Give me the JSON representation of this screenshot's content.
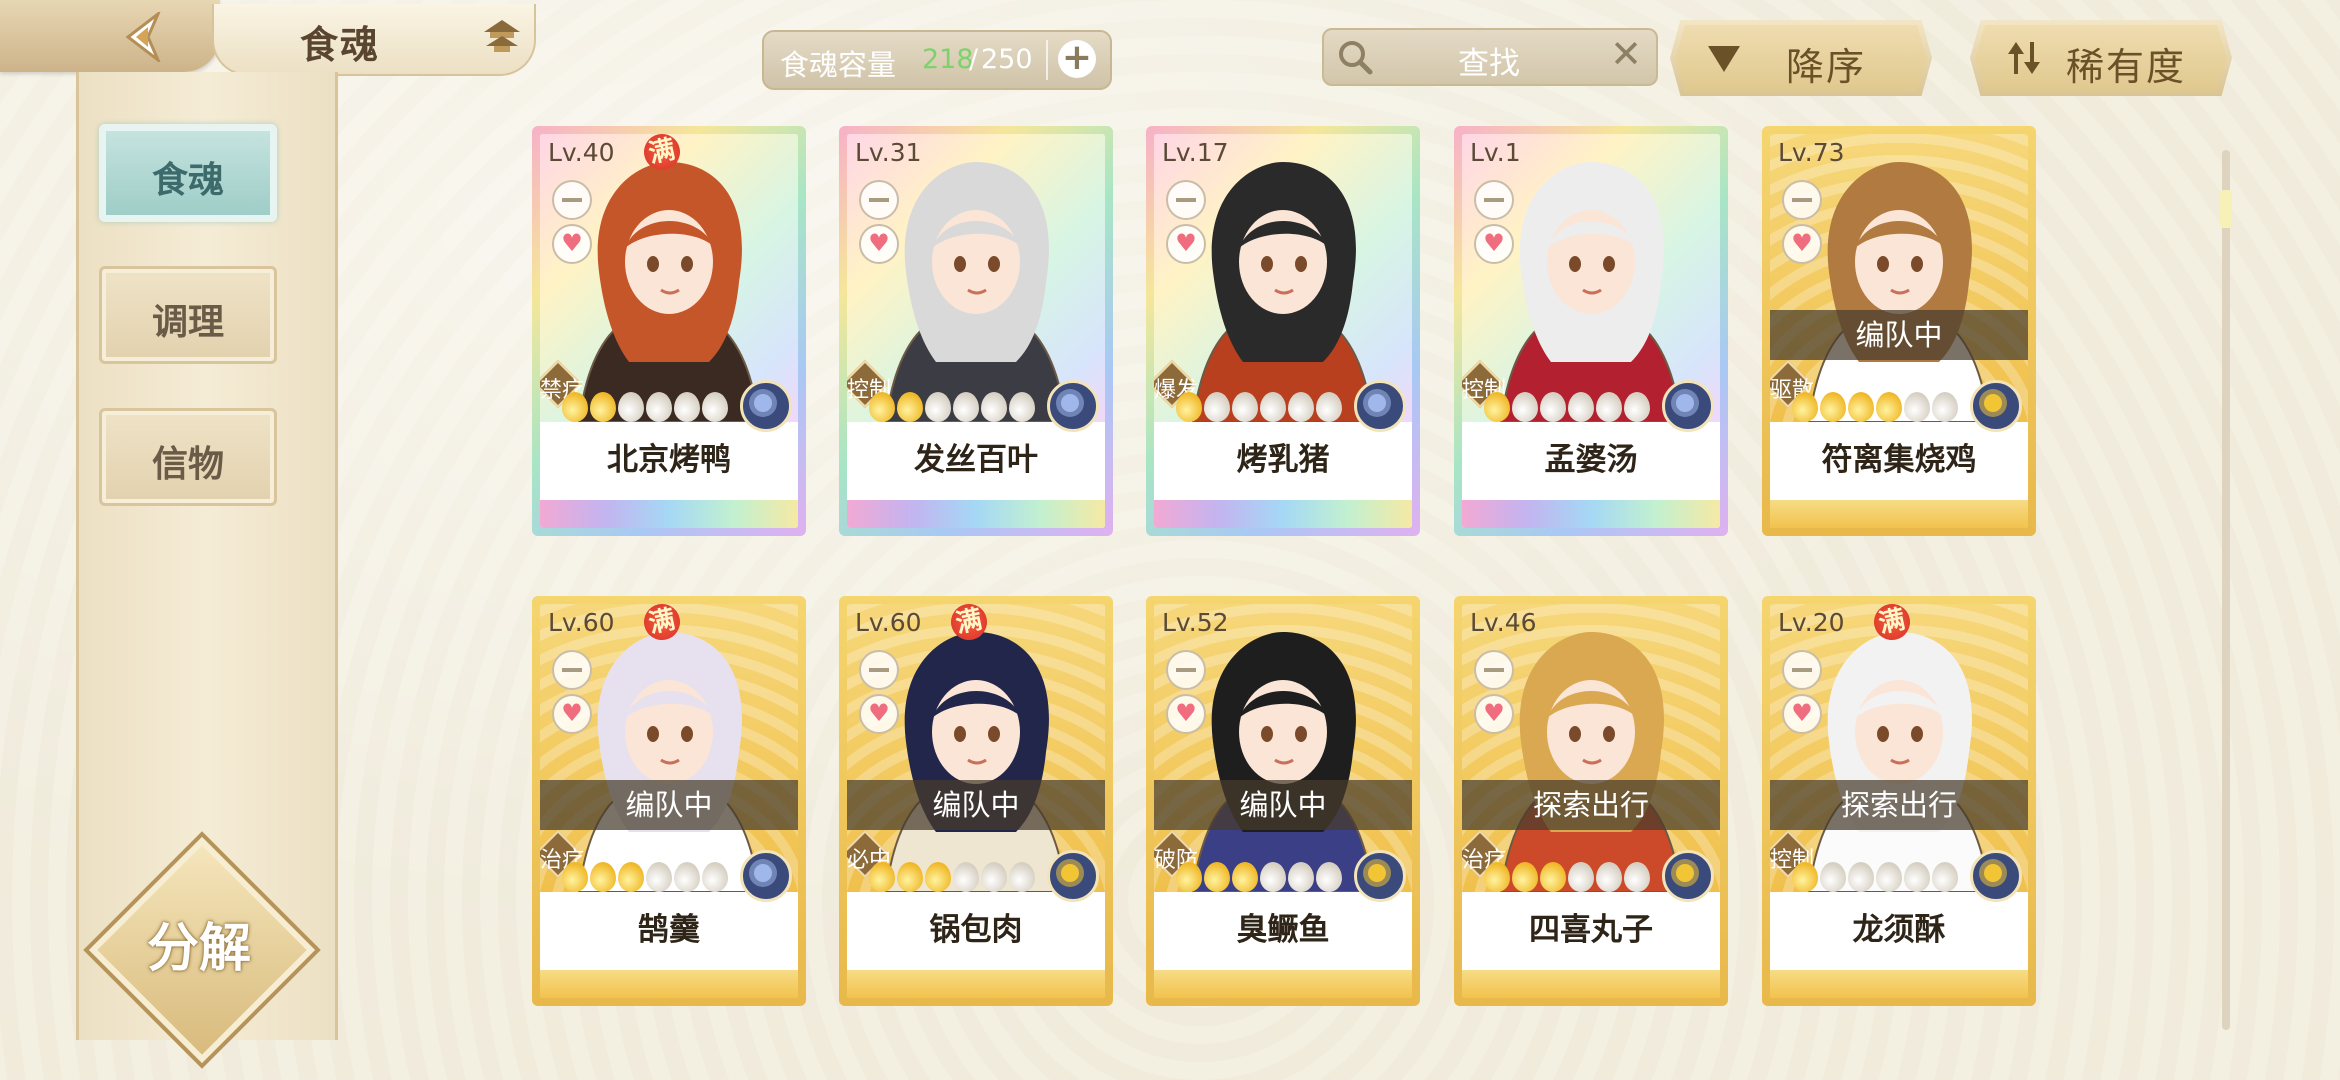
{
  "header": {
    "title": "食魂",
    "capacity": {
      "label": "食魂容量",
      "current": "218",
      "sep": "/",
      "max": "250",
      "plus": "+"
    },
    "search": {
      "placeholder": "查找",
      "clear": "✕"
    },
    "sort_order": "降序",
    "sort_by": "稀有度"
  },
  "sidebar": {
    "tabs": [
      {
        "label": "食魂",
        "active": true
      },
      {
        "label": "调理",
        "active": false
      },
      {
        "label": "信物",
        "active": false
      }
    ],
    "decompose_label": "分解"
  },
  "cards": [
    {
      "level": "Lv.40",
      "full": "满",
      "role": "禁疗",
      "name": "北京烤鸭",
      "frame": "rainbow",
      "stars_on": 2,
      "status": "",
      "emblem": "flower",
      "hair": "#c4562a",
      "outfit": "#3a2a22"
    },
    {
      "level": "Lv.31",
      "full": "",
      "role": "控制",
      "name": "发丝百叶",
      "frame": "rainbow",
      "stars_on": 2,
      "status": "",
      "emblem": "flower",
      "hair": "#d9d9d9",
      "outfit": "#3c3c44"
    },
    {
      "level": "Lv.17",
      "full": "",
      "role": "爆发",
      "name": "烤乳猪",
      "frame": "rainbow",
      "stars_on": 1,
      "status": "",
      "emblem": "flower",
      "hair": "#2a2a2a",
      "outfit": "#b8401e"
    },
    {
      "level": "Lv.1",
      "full": "",
      "role": "控制",
      "name": "孟婆汤",
      "frame": "rainbow",
      "stars_on": 1,
      "status": "",
      "emblem": "flower",
      "hair": "#ededed",
      "outfit": "#b32030"
    },
    {
      "level": "Lv.73",
      "full": "",
      "role": "驱散",
      "name": "符离集烧鸡",
      "frame": "gold",
      "stars_on": 4,
      "status": "编队中",
      "emblem": "gold",
      "hair": "#b07a40",
      "outfit": "#ffffff"
    },
    {
      "level": "Lv.60",
      "full": "满",
      "role": "治疗",
      "name": "鹄羹",
      "frame": "gold",
      "stars_on": 3,
      "status": "编队中",
      "emblem": "flower",
      "hair": "#e7e0ee",
      "outfit": "#ffffff"
    },
    {
      "level": "Lv.60",
      "full": "满",
      "role": "必中",
      "name": "锅包肉",
      "frame": "gold",
      "stars_on": 3,
      "status": "编队中",
      "emblem": "gold",
      "hair": "#22264a",
      "outfit": "#efe6d2"
    },
    {
      "level": "Lv.52",
      "full": "",
      "role": "破防",
      "name": "臭鳜鱼",
      "frame": "gold",
      "stars_on": 3,
      "status": "编队中",
      "emblem": "gold",
      "hair": "#1e1e1e",
      "outfit": "#3a3f86"
    },
    {
      "level": "Lv.46",
      "full": "",
      "role": "治疗",
      "name": "四喜丸子",
      "frame": "gold",
      "stars_on": 3,
      "status": "探索出行",
      "emblem": "gold",
      "hair": "#d9a850",
      "outfit": "#cc4a2a"
    },
    {
      "level": "Lv.20",
      "full": "满",
      "role": "控制",
      "name": "龙须酥",
      "frame": "gold",
      "stars_on": 1,
      "status": "探索出行",
      "emblem": "gold",
      "hair": "#f2f2f2",
      "outfit": "#fbfbfb"
    }
  ],
  "colors": {
    "accent": "#d9c49a",
    "capacity_current": "#7dd26a",
    "gold_frame": "#f0c04c"
  }
}
